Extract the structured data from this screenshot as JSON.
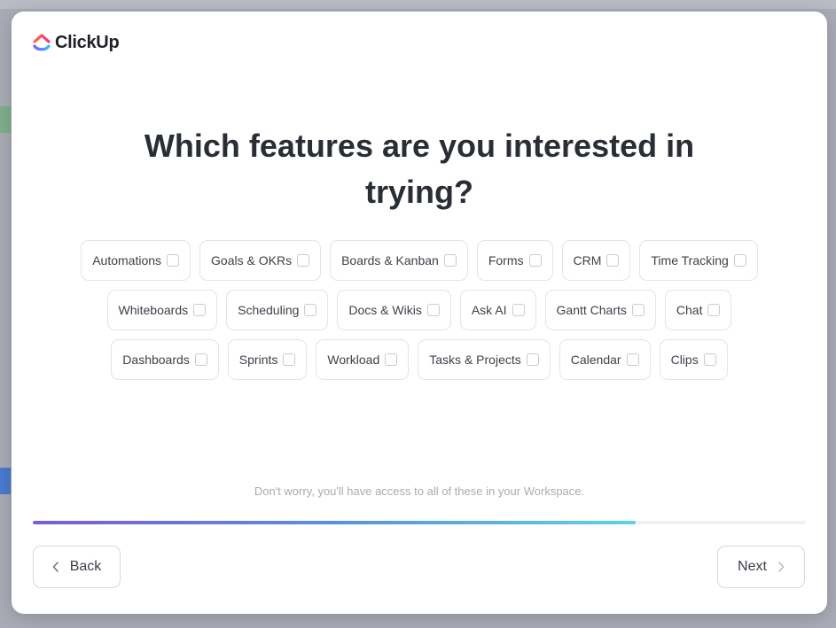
{
  "brand": {
    "name": "ClickUp"
  },
  "title": "Which features are you interested in trying?",
  "feature_rows": [
    [
      {
        "label": "Automations",
        "checked": false
      },
      {
        "label": "Goals & OKRs",
        "checked": false
      },
      {
        "label": "Boards & Kanban",
        "checked": false
      },
      {
        "label": "Forms",
        "checked": false
      },
      {
        "label": "CRM",
        "checked": false
      },
      {
        "label": "Time Tracking",
        "checked": false
      }
    ],
    [
      {
        "label": "Whiteboards",
        "checked": false
      },
      {
        "label": "Scheduling",
        "checked": false
      },
      {
        "label": "Docs & Wikis",
        "checked": false
      },
      {
        "label": "Ask AI",
        "checked": false
      },
      {
        "label": "Gantt Charts",
        "checked": false
      },
      {
        "label": "Chat",
        "checked": false
      }
    ],
    [
      {
        "label": "Dashboards",
        "checked": false
      },
      {
        "label": "Sprints",
        "checked": false
      },
      {
        "label": "Workload",
        "checked": false
      },
      {
        "label": "Tasks & Projects",
        "checked": false
      },
      {
        "label": "Calendar",
        "checked": false
      },
      {
        "label": "Clips",
        "checked": false
      }
    ]
  ],
  "note": "Don't worry, you'll have access to all of these in your Workspace.",
  "progress": {
    "fraction": 0.78
  },
  "buttons": {
    "back": "Back",
    "next": "Next"
  },
  "icons": {
    "back": "chevron-left-icon",
    "next": "chevron-right-icon",
    "logo": "clickup-logo-icon"
  }
}
